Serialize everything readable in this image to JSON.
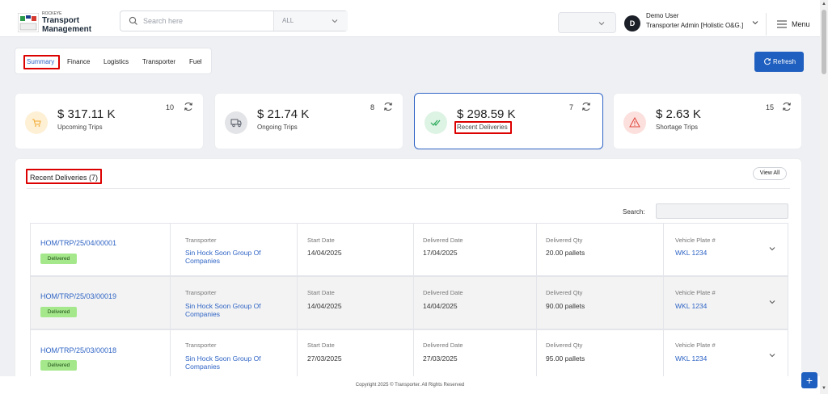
{
  "app": {
    "logo_small": "ROCKEYE",
    "logo_line1": "Transport",
    "logo_line2": "Management",
    "search_placeholder": "Search here",
    "search_scope": "ALL",
    "user_initial": "D",
    "user_name": "Demo User",
    "user_role": "Transporter Admin [Holistic O&G.]",
    "menu_label": "Menu"
  },
  "tabs": [
    {
      "label": "Summary",
      "active": true
    },
    {
      "label": "Finance"
    },
    {
      "label": "Logistics"
    },
    {
      "label": "Transporter"
    },
    {
      "label": "Fuel"
    }
  ],
  "refresh_label": "Refresh",
  "stats": [
    {
      "value": "$ 317.11 K",
      "label": "Upcoming Trips",
      "count": "10",
      "icon": "cart-icon",
      "color": "#f2a930"
    },
    {
      "value": "$ 21.74 K",
      "label": "Ongoing Trips",
      "count": "8",
      "icon": "truck-icon",
      "color": "#555b66"
    },
    {
      "value": "$ 298.59 K",
      "label": "Recent Deliveries",
      "count": "7",
      "icon": "check-double-icon",
      "color": "#2eab5c"
    },
    {
      "value": "$ 2.63 K",
      "label": "Shortage Trips",
      "count": "15",
      "icon": "warning-icon",
      "color": "#e0443a"
    }
  ],
  "deliveries": {
    "title": "Recent Deliveries (7)",
    "view_all": "View All",
    "search_label": "Search:",
    "headers": {
      "transporter": "Transporter",
      "start_date": "Start Date",
      "delivered_date": "Delivered Date",
      "delivered_qty": "Delivered Qty",
      "vehicle_plate": "Vehicle Plate #"
    },
    "rows": [
      {
        "trip_id": "HOM/TRP/25/04/00001",
        "status": "Delivered",
        "transporter_l1": "Sin Hock Soon Group Of",
        "transporter_l2": "Companies",
        "start_date": "14/04/2025",
        "delivered_date": "17/04/2025",
        "qty": "20.00 pallets",
        "plate": "WKL 1234"
      },
      {
        "trip_id": "HOM/TRP/25/03/00019",
        "status": "Delivered",
        "transporter_l1": "Sin Hock Soon Group Of",
        "transporter_l2": "Companies",
        "start_date": "14/04/2025",
        "delivered_date": "14/04/2025",
        "qty": "90.00 pallets",
        "plate": "WKL 1234"
      },
      {
        "trip_id": "HOM/TRP/25/03/00018",
        "status": "Delivered",
        "transporter_l1": "Sin Hock Soon Group Of",
        "transporter_l2": "Companies",
        "start_date": "27/03/2025",
        "delivered_date": "27/03/2025",
        "qty": "95.00 pallets",
        "plate": "WKL 1234"
      }
    ]
  },
  "footer": "Copyright 2025 © Transporter. All Rights Reserved",
  "fab_label": "+"
}
